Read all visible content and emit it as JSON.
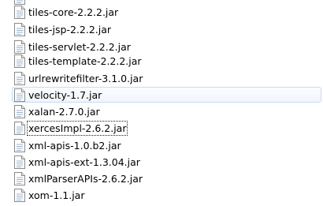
{
  "file_list": {
    "icon": "jar-file-icon",
    "items": [
      {
        "name": "tiles-core-2.2.2.jar",
        "state": "normal"
      },
      {
        "name": "tiles-jsp-2.2.2.jar",
        "state": "normal"
      },
      {
        "name": "tiles-servlet-2.2.2.jar",
        "state": "normal"
      },
      {
        "name": "tiles-template-2.2.2.jar",
        "state": "normal"
      },
      {
        "name": "urlrewritefilter-3.1.0.jar",
        "state": "normal"
      },
      {
        "name": "velocity-1.7.jar",
        "state": "hovered"
      },
      {
        "name": "xalan-2.7.0.jar",
        "state": "normal"
      },
      {
        "name": "xercesImpl-2.6.2.jar",
        "state": "focused"
      },
      {
        "name": "xml-apis-1.0.b2.jar",
        "state": "normal"
      },
      {
        "name": "xml-apis-ext-1.3.04.jar",
        "state": "normal"
      },
      {
        "name": "xmlParserAPIs-2.6.2.jar",
        "state": "normal"
      },
      {
        "name": "xom-1.1.jar",
        "state": "normal"
      }
    ]
  },
  "colors": {
    "hover_border": "#c7ddf2",
    "hover_fill": "#f0f6fd",
    "text": "#000000"
  }
}
